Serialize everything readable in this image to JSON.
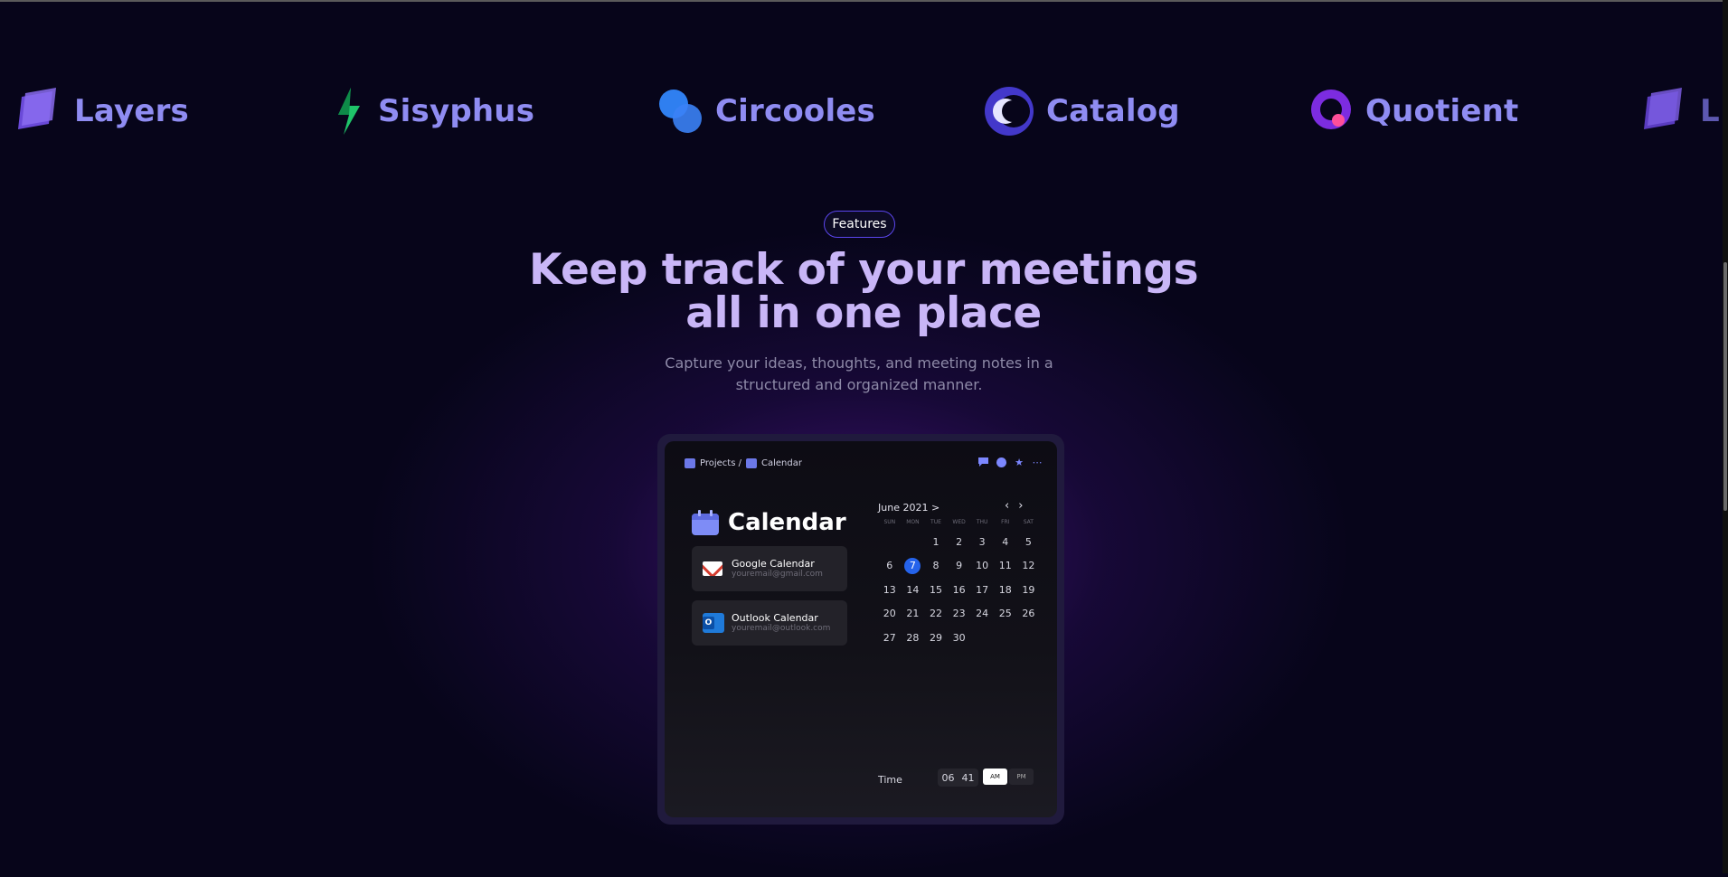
{
  "logos": [
    {
      "name": "Layers",
      "icon": "layers-icon"
    },
    {
      "name": "Sisyphus",
      "icon": "sisyphus-icon"
    },
    {
      "name": "Circooles",
      "icon": "circooles-icon"
    },
    {
      "name": "Catalog",
      "icon": "catalog-icon"
    },
    {
      "name": "Quotient",
      "icon": "quotient-icon"
    },
    {
      "name": "L",
      "icon": "layers-icon"
    }
  ],
  "features_badge": "Features",
  "headline": "Keep track of your meetings all in one place",
  "subheadline": "Capture your ideas, thoughts, and meeting notes in a structured and organized manner.",
  "app": {
    "breadcrumb": {
      "projects": "Projects /",
      "calendar": "Calendar"
    },
    "title": "Calendar",
    "accounts": [
      {
        "name": "Google Calendar",
        "email": "youremail@gmail.com",
        "icon": "gmail-icon"
      },
      {
        "name": "Outlook Calendar",
        "email": "youremail@outlook.com",
        "icon": "outlook-icon"
      }
    ],
    "month_label": "June 2021 >",
    "weekdays": [
      "SUN",
      "MON",
      "TUE",
      "WED",
      "THU",
      "FRI",
      "SAT"
    ],
    "days": [
      "",
      "",
      "1",
      "2",
      "3",
      "4",
      "5",
      "6",
      "7",
      "8",
      "9",
      "10",
      "11",
      "12",
      "13",
      "14",
      "15",
      "16",
      "17",
      "18",
      "19",
      "20",
      "21",
      "22",
      "23",
      "24",
      "25",
      "26",
      "27",
      "28",
      "29",
      "30"
    ],
    "selected_day": "7",
    "time_label": "Time",
    "hour": "06",
    "minute": "41",
    "am": "AM",
    "pm": "PM"
  },
  "colors": {
    "accent": "#2563eb",
    "heading": "#c9b6f7",
    "logo": "#8f8cf2",
    "background": "#07051a"
  }
}
